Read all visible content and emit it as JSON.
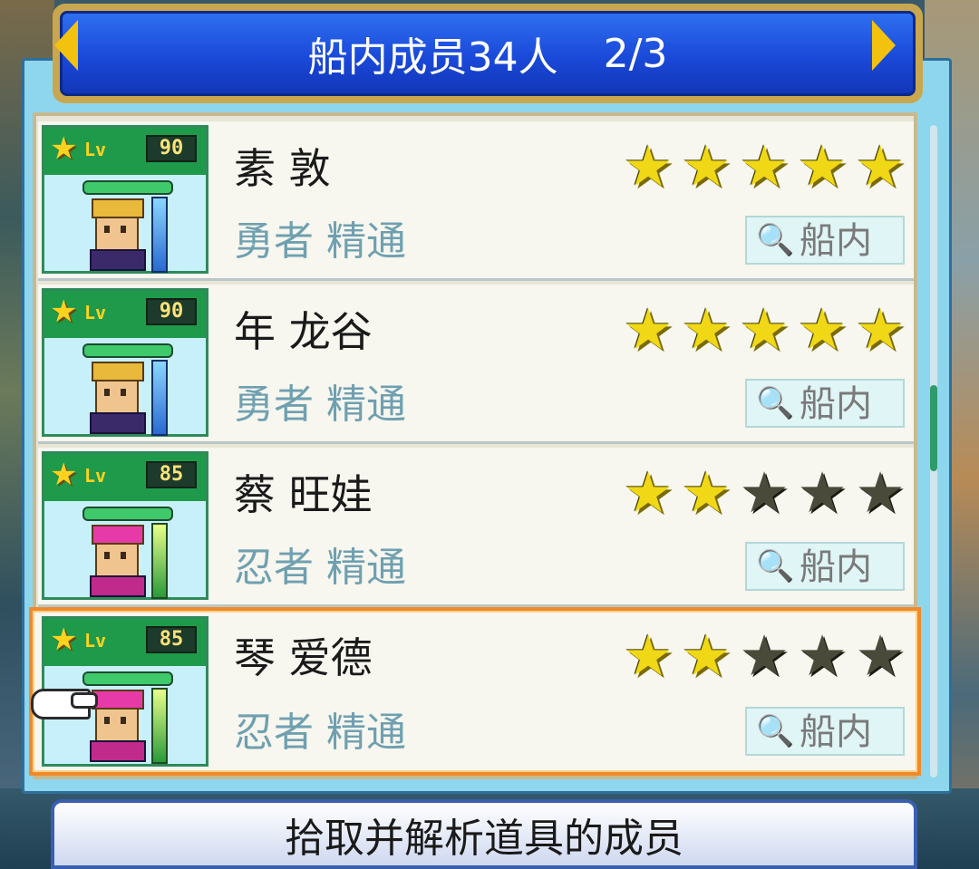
{
  "header": {
    "title": "船内成员34人",
    "page": "2/3"
  },
  "members": [
    {
      "name": "素 敦",
      "role": "勇者 精通",
      "lv_label": "Lv",
      "level": "90",
      "rating": 5,
      "max_rating": 5,
      "location": "船内",
      "selected": false
    },
    {
      "name": "年 龙谷",
      "role": "勇者 精通",
      "lv_label": "Lv",
      "level": "90",
      "rating": 5,
      "max_rating": 5,
      "location": "船内",
      "selected": false
    },
    {
      "name": "蔡 旺娃",
      "role": "忍者 精通",
      "lv_label": "Lv",
      "level": "85",
      "rating": 2,
      "max_rating": 5,
      "location": "船内",
      "selected": false
    },
    {
      "name": "琴 爱德",
      "role": "忍者 精通",
      "lv_label": "Lv",
      "level": "85",
      "rating": 2,
      "max_rating": 5,
      "location": "船内",
      "selected": true
    }
  ],
  "footer": {
    "text": "拾取并解析道具的成员"
  },
  "colors": {
    "banner": "#1a49d9",
    "selected_border": "#f08a2a",
    "star_on": "#f0d817",
    "star_off": "#4a4a3a"
  },
  "icons": [
    "arrow-left-icon",
    "arrow-right-icon",
    "star-icon",
    "magnifier-icon",
    "pointing-hand-icon"
  ]
}
